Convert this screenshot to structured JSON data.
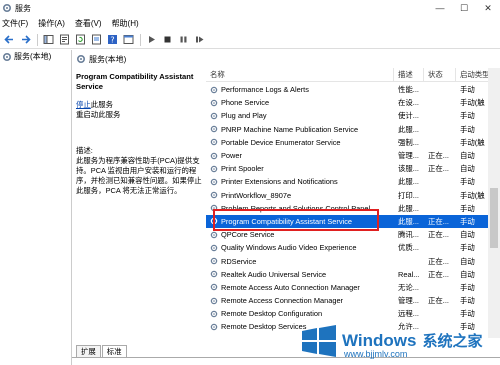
{
  "window": {
    "title": "服务",
    "min": "—",
    "max": "☐",
    "close": "✕"
  },
  "menu": [
    "文件(F)",
    "操作(A)",
    "查看(V)",
    "帮助(H)"
  ],
  "tree": {
    "root": "服务(本地)"
  },
  "header": {
    "left": "服务(本地)"
  },
  "detail": {
    "service_name": "Program Compatibility Assistant Service",
    "stop_link": "停止",
    "stop_suffix": "此服务",
    "restart_link": "重启动",
    "restart_suffix": "此服务",
    "desc_label": "描述:",
    "desc_text": "此服务为程序兼容性助手(PCA)提供支持。PCA 监视由用户安装和运行的程序，并检测已知兼容性问题。如果停止此服务，PCA 将无法正常运行。"
  },
  "columns": {
    "name": "名称",
    "desc": "描述",
    "status": "状态",
    "startup": "启动类型"
  },
  "rows": [
    {
      "name": "Performance Logs & Alerts",
      "desc": "性能...",
      "status": "",
      "startup": "手动"
    },
    {
      "name": "Phone Service",
      "desc": "在设...",
      "status": "",
      "startup": "手动(触"
    },
    {
      "name": "Plug and Play",
      "desc": "使计...",
      "status": "",
      "startup": "手动"
    },
    {
      "name": "PNRP Machine Name Publication Service",
      "desc": "此服...",
      "status": "",
      "startup": "手动"
    },
    {
      "name": "Portable Device Enumerator Service",
      "desc": "强制...",
      "status": "",
      "startup": "手动(触"
    },
    {
      "name": "Power",
      "desc": "管理...",
      "status": "正在...",
      "startup": "自动"
    },
    {
      "name": "Print Spooler",
      "desc": "该服...",
      "status": "正在...",
      "startup": "自动"
    },
    {
      "name": "Printer Extensions and Notifications",
      "desc": "此服...",
      "status": "",
      "startup": "手动"
    },
    {
      "name": "PrintWorkflow_8907e",
      "desc": "打印...",
      "status": "",
      "startup": "手动(触"
    },
    {
      "name": "Problem Reports and Solutions Control Panel...",
      "desc": "此服...",
      "status": "",
      "startup": "手动"
    },
    {
      "name": "Program Compatibility Assistant Service",
      "desc": "此服...",
      "status": "正在...",
      "startup": "手动",
      "selected": true
    },
    {
      "name": "QPCore Service",
      "desc": "腾讯...",
      "status": "正在...",
      "startup": "自动"
    },
    {
      "name": "Quality Windows Audio Video Experience",
      "desc": "优质...",
      "status": "",
      "startup": "手动"
    },
    {
      "name": "RDService",
      "desc": "",
      "status": "正在...",
      "startup": "自动"
    },
    {
      "name": "Realtek Audio Universal Service",
      "desc": "Real...",
      "status": "正在...",
      "startup": "自动"
    },
    {
      "name": "Remote Access Auto Connection Manager",
      "desc": "无论...",
      "status": "",
      "startup": "手动"
    },
    {
      "name": "Remote Access Connection Manager",
      "desc": "管理...",
      "status": "正在...",
      "startup": "手动"
    },
    {
      "name": "Remote Desktop Configuration",
      "desc": "远程...",
      "status": "",
      "startup": "手动"
    },
    {
      "name": "Remote Desktop Services",
      "desc": "允许...",
      "status": "",
      "startup": "手动"
    }
  ],
  "tabs": [
    "扩展",
    "标准"
  ],
  "watermark": {
    "brand": "Windows",
    "cn": "系统之家",
    "url": "www.bjjmlv.com"
  },
  "colors": {
    "selection": "#0a64d8",
    "highlight_box": "#e02020",
    "link": "#0645ad",
    "watermark": "#1e73be"
  }
}
